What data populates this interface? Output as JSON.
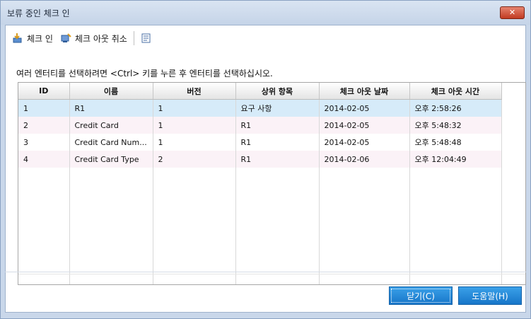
{
  "window": {
    "title": "보류 중인 체크 인",
    "close_label": "✕"
  },
  "toolbar": {
    "checkin_label": "체크 인",
    "undo_checkout_label": "체크 아웃 취소"
  },
  "hint": "여러 엔터티를 선택하려면 <Ctrl> 키를 누른 후 엔터티를 선택하십시오.",
  "grid": {
    "columns": [
      "ID",
      "이름",
      "버전",
      "상위 항목",
      "체크 아웃 날짜",
      "체크 아웃 시간"
    ],
    "rows": [
      [
        "1",
        "R1",
        "1",
        "요구 사항",
        "2014-02-05",
        "오후 2:58:26"
      ],
      [
        "2",
        "Credit Card",
        "1",
        "R1",
        "2014-02-05",
        "오후 5:48:32"
      ],
      [
        "3",
        "Credit Card Num...",
        "1",
        "R1",
        "2014-02-05",
        "오후 5:48:48"
      ],
      [
        "4",
        "Credit Card Type",
        "2",
        "R1",
        "2014-02-06",
        "오후 12:04:49"
      ]
    ]
  },
  "buttons": {
    "close_label": "닫기(C)",
    "help_label": "도움말(H)"
  },
  "colors": {
    "accent": "#1a86d8",
    "selected_row": "#d6ebf9",
    "alt_row": "#fbf2f7"
  }
}
